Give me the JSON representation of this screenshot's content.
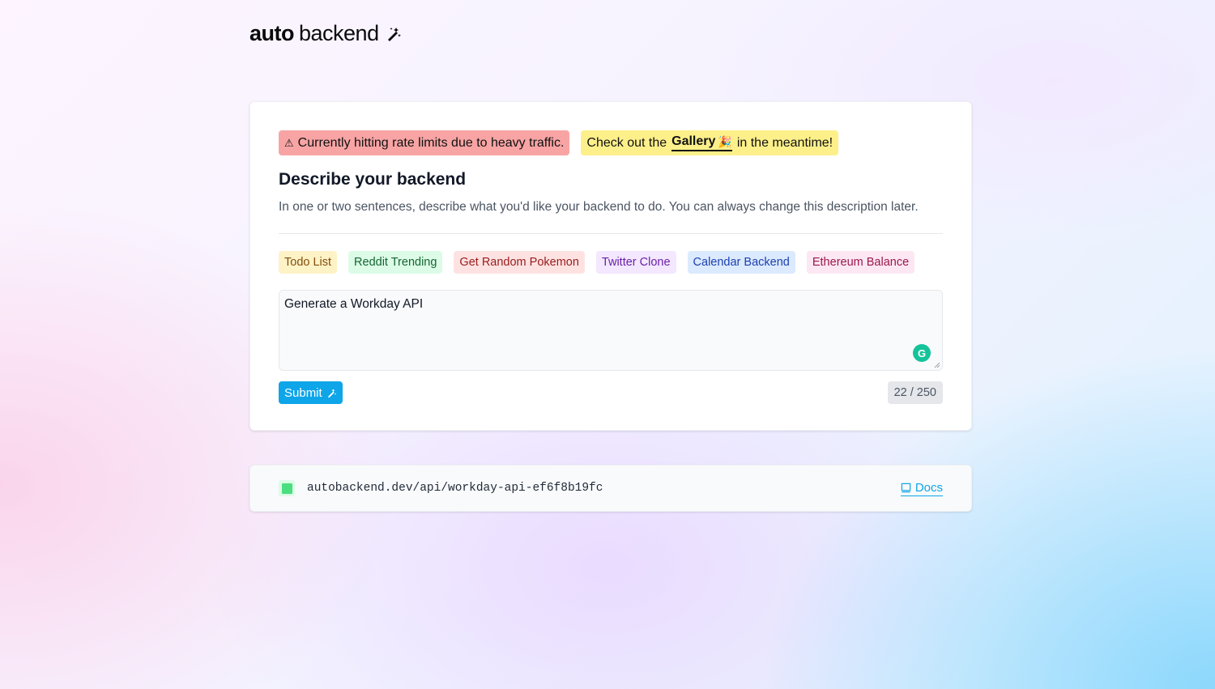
{
  "brand": {
    "logo_bold": "auto",
    "logo_regular": "backend",
    "logo_icon": "magic-wand-icon"
  },
  "alerts": {
    "rate_limit_icon": "⚠",
    "rate_limit": "Currently hitting rate limits due to heavy traffic.",
    "gallery_prefix": "Check out the",
    "gallery_link": "Gallery",
    "gallery_icon": "🎉",
    "gallery_suffix": "in the meantime!"
  },
  "form": {
    "heading": "Describe your backend",
    "description": "In one or two sentences, describe what you'd like your backend to do. You can always change this description later.",
    "examples": [
      {
        "label": "Todo List",
        "color": "#fef3c7"
      },
      {
        "label": "Reddit Trending",
        "color": "#dcfce7"
      },
      {
        "label": "Get Random Pokemon",
        "color": "#fee2e2"
      },
      {
        "label": "Twitter Clone",
        "color": "#f3e8ff"
      },
      {
        "label": "Calendar Backend",
        "color": "#dbeafe"
      },
      {
        "label": "Ethereum Balance",
        "color": "#fce7f3"
      }
    ],
    "input_value": "Generate a Workday API",
    "grammarly_icon": "G",
    "submit_label": "Submit",
    "submit_icon": "magic-wand-icon",
    "char_count": "22 / 250"
  },
  "endpoint": {
    "status_color": "#4ade80",
    "url": "autobackend.dev/api/workday-api-ef6f8b19fc",
    "docs_label": "Docs",
    "docs_icon": "book-icon"
  },
  "colors": {
    "accent": "#0ea5e9",
    "alert_red": "#f8a4a4",
    "alert_yellow": "#fdf08a"
  }
}
